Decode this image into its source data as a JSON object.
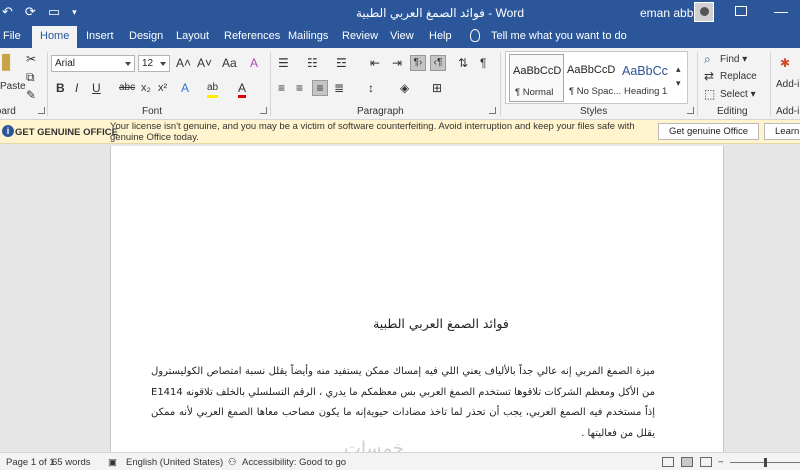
{
  "window": {
    "title": "فوائد الصمغ العربي الطبية  -  Word",
    "user_name": "eman abbas"
  },
  "tabs": [
    "File",
    "Home",
    "Insert",
    "Design",
    "Layout",
    "References",
    "Mailings",
    "Review",
    "View",
    "Help"
  ],
  "active_tab": "Home",
  "tell_me": "Tell me what you want to do",
  "ribbon": {
    "clipboard": {
      "label": "Clipboard",
      "paste": "Paste"
    },
    "font": {
      "label": "Font",
      "name": "Arial",
      "size": "12"
    },
    "paragraph": {
      "label": "Paragraph"
    },
    "styles": {
      "label": "Styles",
      "items": [
        {
          "sample": "AaBbCcD",
          "name": "¶ Normal"
        },
        {
          "sample": "AaBbCcD",
          "name": "¶ No Spac..."
        },
        {
          "sample": "AaBbCc",
          "name": "Heading 1"
        }
      ]
    },
    "editing": {
      "label": "Editing",
      "find": "Find",
      "replace": "Replace",
      "select": "Select"
    },
    "addins": {
      "label": "Add-ins",
      "button": "Add-ins"
    }
  },
  "message_bar": {
    "title": "GET GENUINE OFFICE",
    "text": "Your license isn't genuine, and you may be a victim of software counterfeiting. Avoid interruption and keep your files safe with genuine Office today.",
    "button1": "Get genuine Office",
    "button2": "Learn more"
  },
  "document": {
    "title": "فوائد الصمغ العربي الطبية",
    "body": "ميزة الصمغ المربي إنه عالي جداً بالألياف يعني اللي فيه إمساك ممكن يستفيد منه وأيضاً يقلل نسبة امتصاص الكوليسترول من الأكل ومعظم الشركات تلاقوها تستخدم الصمغ العربي بس معظمكم ما يدري ، الرقم التسلسلي بالخلف تلاقونه  E1414  إذاً مستخدم فيه الصمغ العربي، يجب أن تحذر لما تاخذ مضادات حيويةإنه ما يكون مصاحب معاها الصمغ العربي لأنه ممكن يقلل من فعاليتها  ."
  },
  "watermark": "خمسات",
  "status": {
    "page": "Page 1 of 1",
    "words": "65 words",
    "language": "English (United States)",
    "accessibility": "Accessibility: Good to go"
  },
  "colors": {
    "accent": "#2b579a",
    "message_bg": "#fff4ce"
  }
}
